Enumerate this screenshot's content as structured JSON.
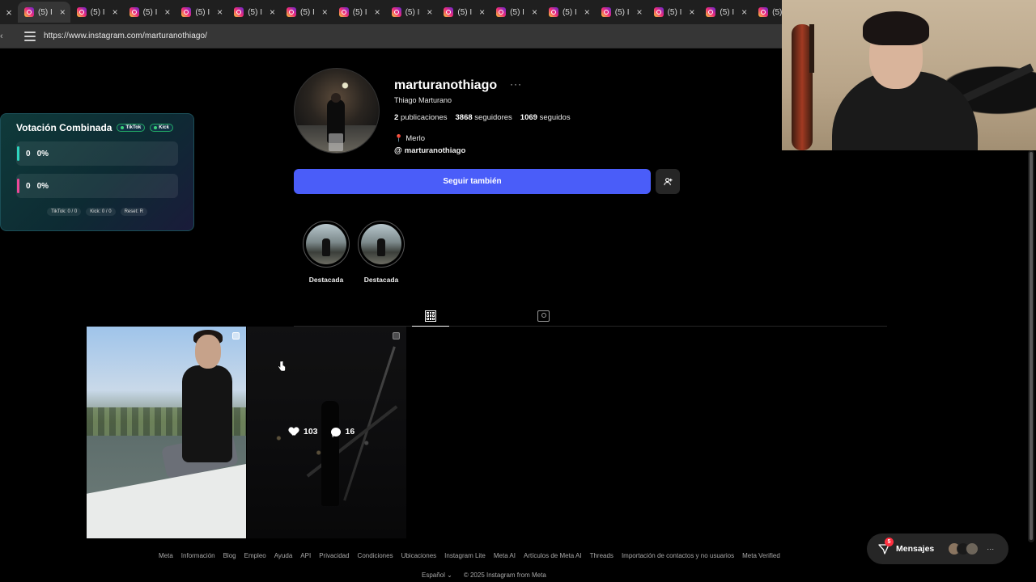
{
  "browser": {
    "tab_label": "(5) I",
    "tab_count": 15,
    "url": "https://www.instagram.com/marturanothiago/"
  },
  "vote_widget": {
    "title": "Votación Combinada",
    "badges": [
      "TikTok",
      "Kick"
    ],
    "options": [
      {
        "count": "0",
        "percent": "0%",
        "color": "#2dd4bf"
      },
      {
        "count": "0",
        "percent": "0%",
        "color": "#ec4899"
      }
    ],
    "footer": [
      "TikTok: 0 / 0",
      "Kick: 0 / 0",
      "Reset: R"
    ]
  },
  "profile": {
    "username": "marturanothiago",
    "more": "···",
    "full_name": "Thiago Marturano",
    "posts_count": "2",
    "posts_label": "publicaciones",
    "followers_count": "3868",
    "followers_label": "seguidores",
    "following_count": "1069",
    "following_label": "seguidos",
    "location": "Merlo",
    "threads_handle": "marturanothiago",
    "follow_button": "Seguir también",
    "suggest_icon": "person-add-icon"
  },
  "highlights": [
    {
      "label": "Destacada"
    },
    {
      "label": "Destacada"
    }
  ],
  "posts": [
    {
      "likes": "",
      "comments": ""
    },
    {
      "likes": "103",
      "comments": "16"
    }
  ],
  "footer": {
    "links": [
      "Meta",
      "Información",
      "Blog",
      "Empleo",
      "Ayuda",
      "API",
      "Privacidad",
      "Condiciones",
      "Ubicaciones",
      "Instagram Lite",
      "Meta AI",
      "Artículos de Meta AI",
      "Threads",
      "Importación de contactos y no usuarios",
      "Meta Verified"
    ],
    "language": "Español",
    "copyright": "© 2025 Instagram from Meta"
  },
  "messages": {
    "label": "Mensajes",
    "badge": "5",
    "more": "···"
  },
  "colors": {
    "follow_button": "#4a5df9",
    "background": "#000000"
  }
}
